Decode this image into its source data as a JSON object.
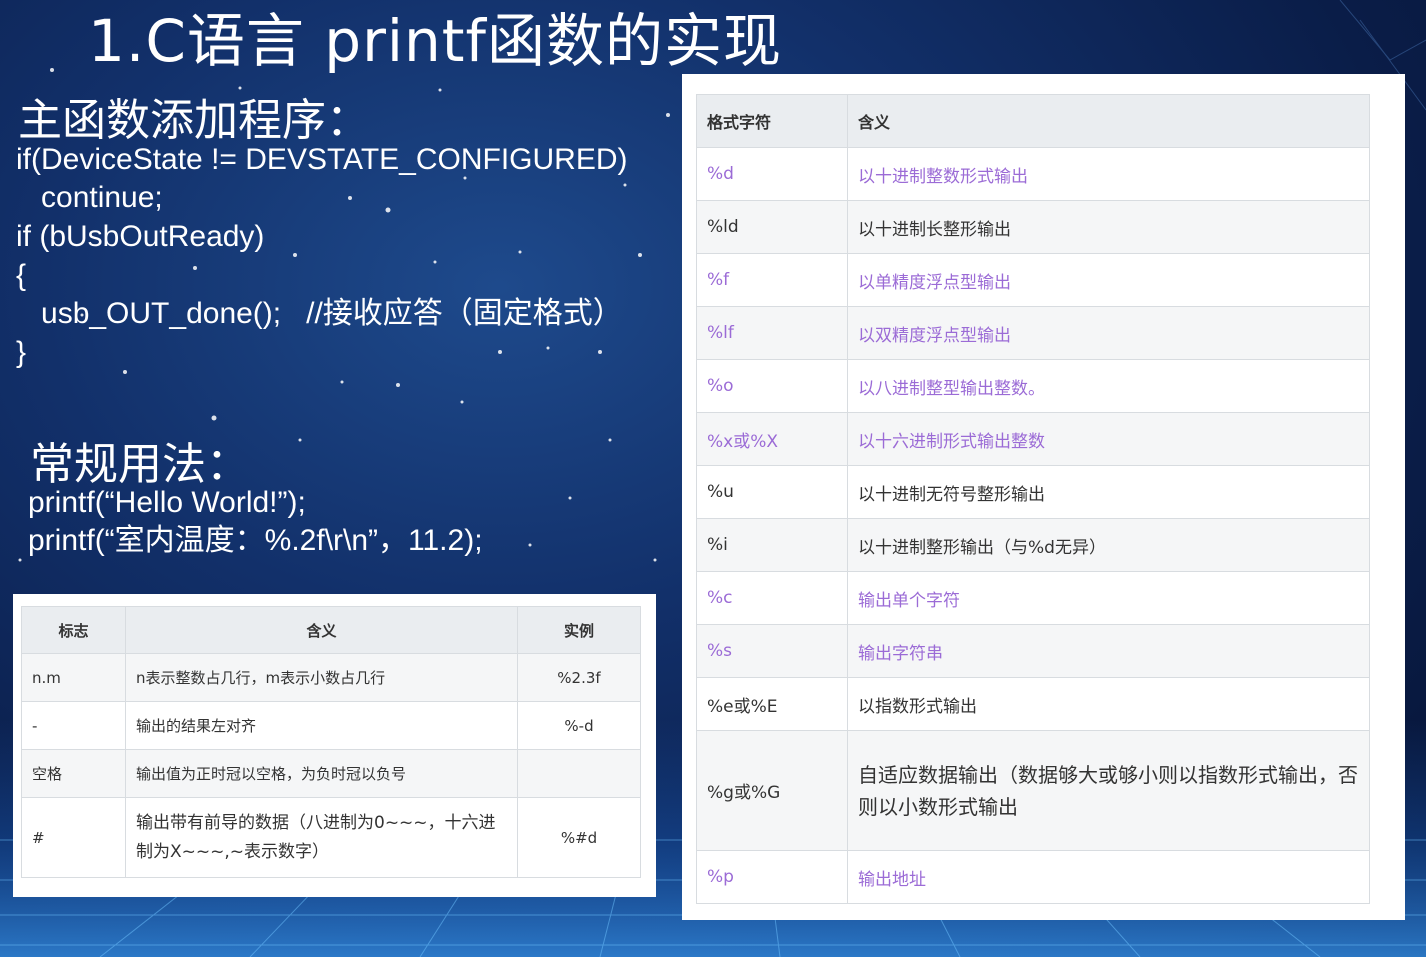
{
  "title": "1.C语言 printf函数的实现",
  "main_heading": "主函数添加程序：",
  "code_lines": [
    "if(DeviceState != DEVSTATE_CONFIGURED)",
    "   continue;",
    "if (bUsbOutReady)",
    "{",
    "   usb_OUT_done();   //接收应答（固定格式）",
    "}"
  ],
  "usage_heading": "常规用法：",
  "usage_lines": [
    "printf(“Hello World!”);",
    "printf(“室内温度：%.2f\\r\\n”，11.2);"
  ],
  "format_table": {
    "headers": [
      "格式字符",
      "含义"
    ],
    "rows": [
      {
        "code": "%d",
        "meaning": "以十进制整数形式输出",
        "link": true
      },
      {
        "code": "%ld",
        "meaning": "以十进制长整形输出",
        "link": false
      },
      {
        "code": "%f",
        "meaning": "以单精度浮点型输出",
        "link": true
      },
      {
        "code": "%lf",
        "meaning": "以双精度浮点型输出",
        "link": true
      },
      {
        "code": "%o",
        "meaning": "以八进制整型输出整数。",
        "link": true
      },
      {
        "code": "%x或%X",
        "meaning": "以十六进制形式输出整数",
        "link": true
      },
      {
        "code": "%u",
        "meaning": "以十进制无符号整形输出",
        "link": false
      },
      {
        "code": "%i",
        "meaning": "以十进制整形输出（与%d无异）",
        "link": false
      },
      {
        "code": "%c",
        "meaning": "输出单个字符",
        "link": true
      },
      {
        "code": "%s",
        "meaning": "输出字符串",
        "link": true
      },
      {
        "code": "%e或%E",
        "meaning": "以指数形式输出",
        "link": false
      },
      {
        "code": "%g或%G",
        "meaning": "自适应数据输出（数据够大或够小则以指数形式输出，否则以小数形式输出",
        "link": false
      },
      {
        "code": "%p",
        "meaning": "输出地址",
        "link": true
      }
    ]
  },
  "flag_table": {
    "headers": [
      "标志",
      "含义",
      "实例"
    ],
    "rows": [
      {
        "flag": "n.m",
        "meaning": "n表示整数占几行，m表示小数占几行",
        "example": "%2.3f"
      },
      {
        "flag": "-",
        "meaning": "输出的结果左对齐",
        "example": "%-d"
      },
      {
        "flag": "空格",
        "meaning": "输出值为正时冠以空格，为负时冠以负号",
        "example": ""
      },
      {
        "flag": "#",
        "meaning": "输出带有前导的数据（八进制为0~~~，十六进制为X~~~,~表示数字）",
        "example": "%#d"
      }
    ]
  },
  "colors": {
    "link": "#9b6bd6",
    "header_bg": "#eaedf0",
    "bg_dark": "#0a1d48"
  }
}
